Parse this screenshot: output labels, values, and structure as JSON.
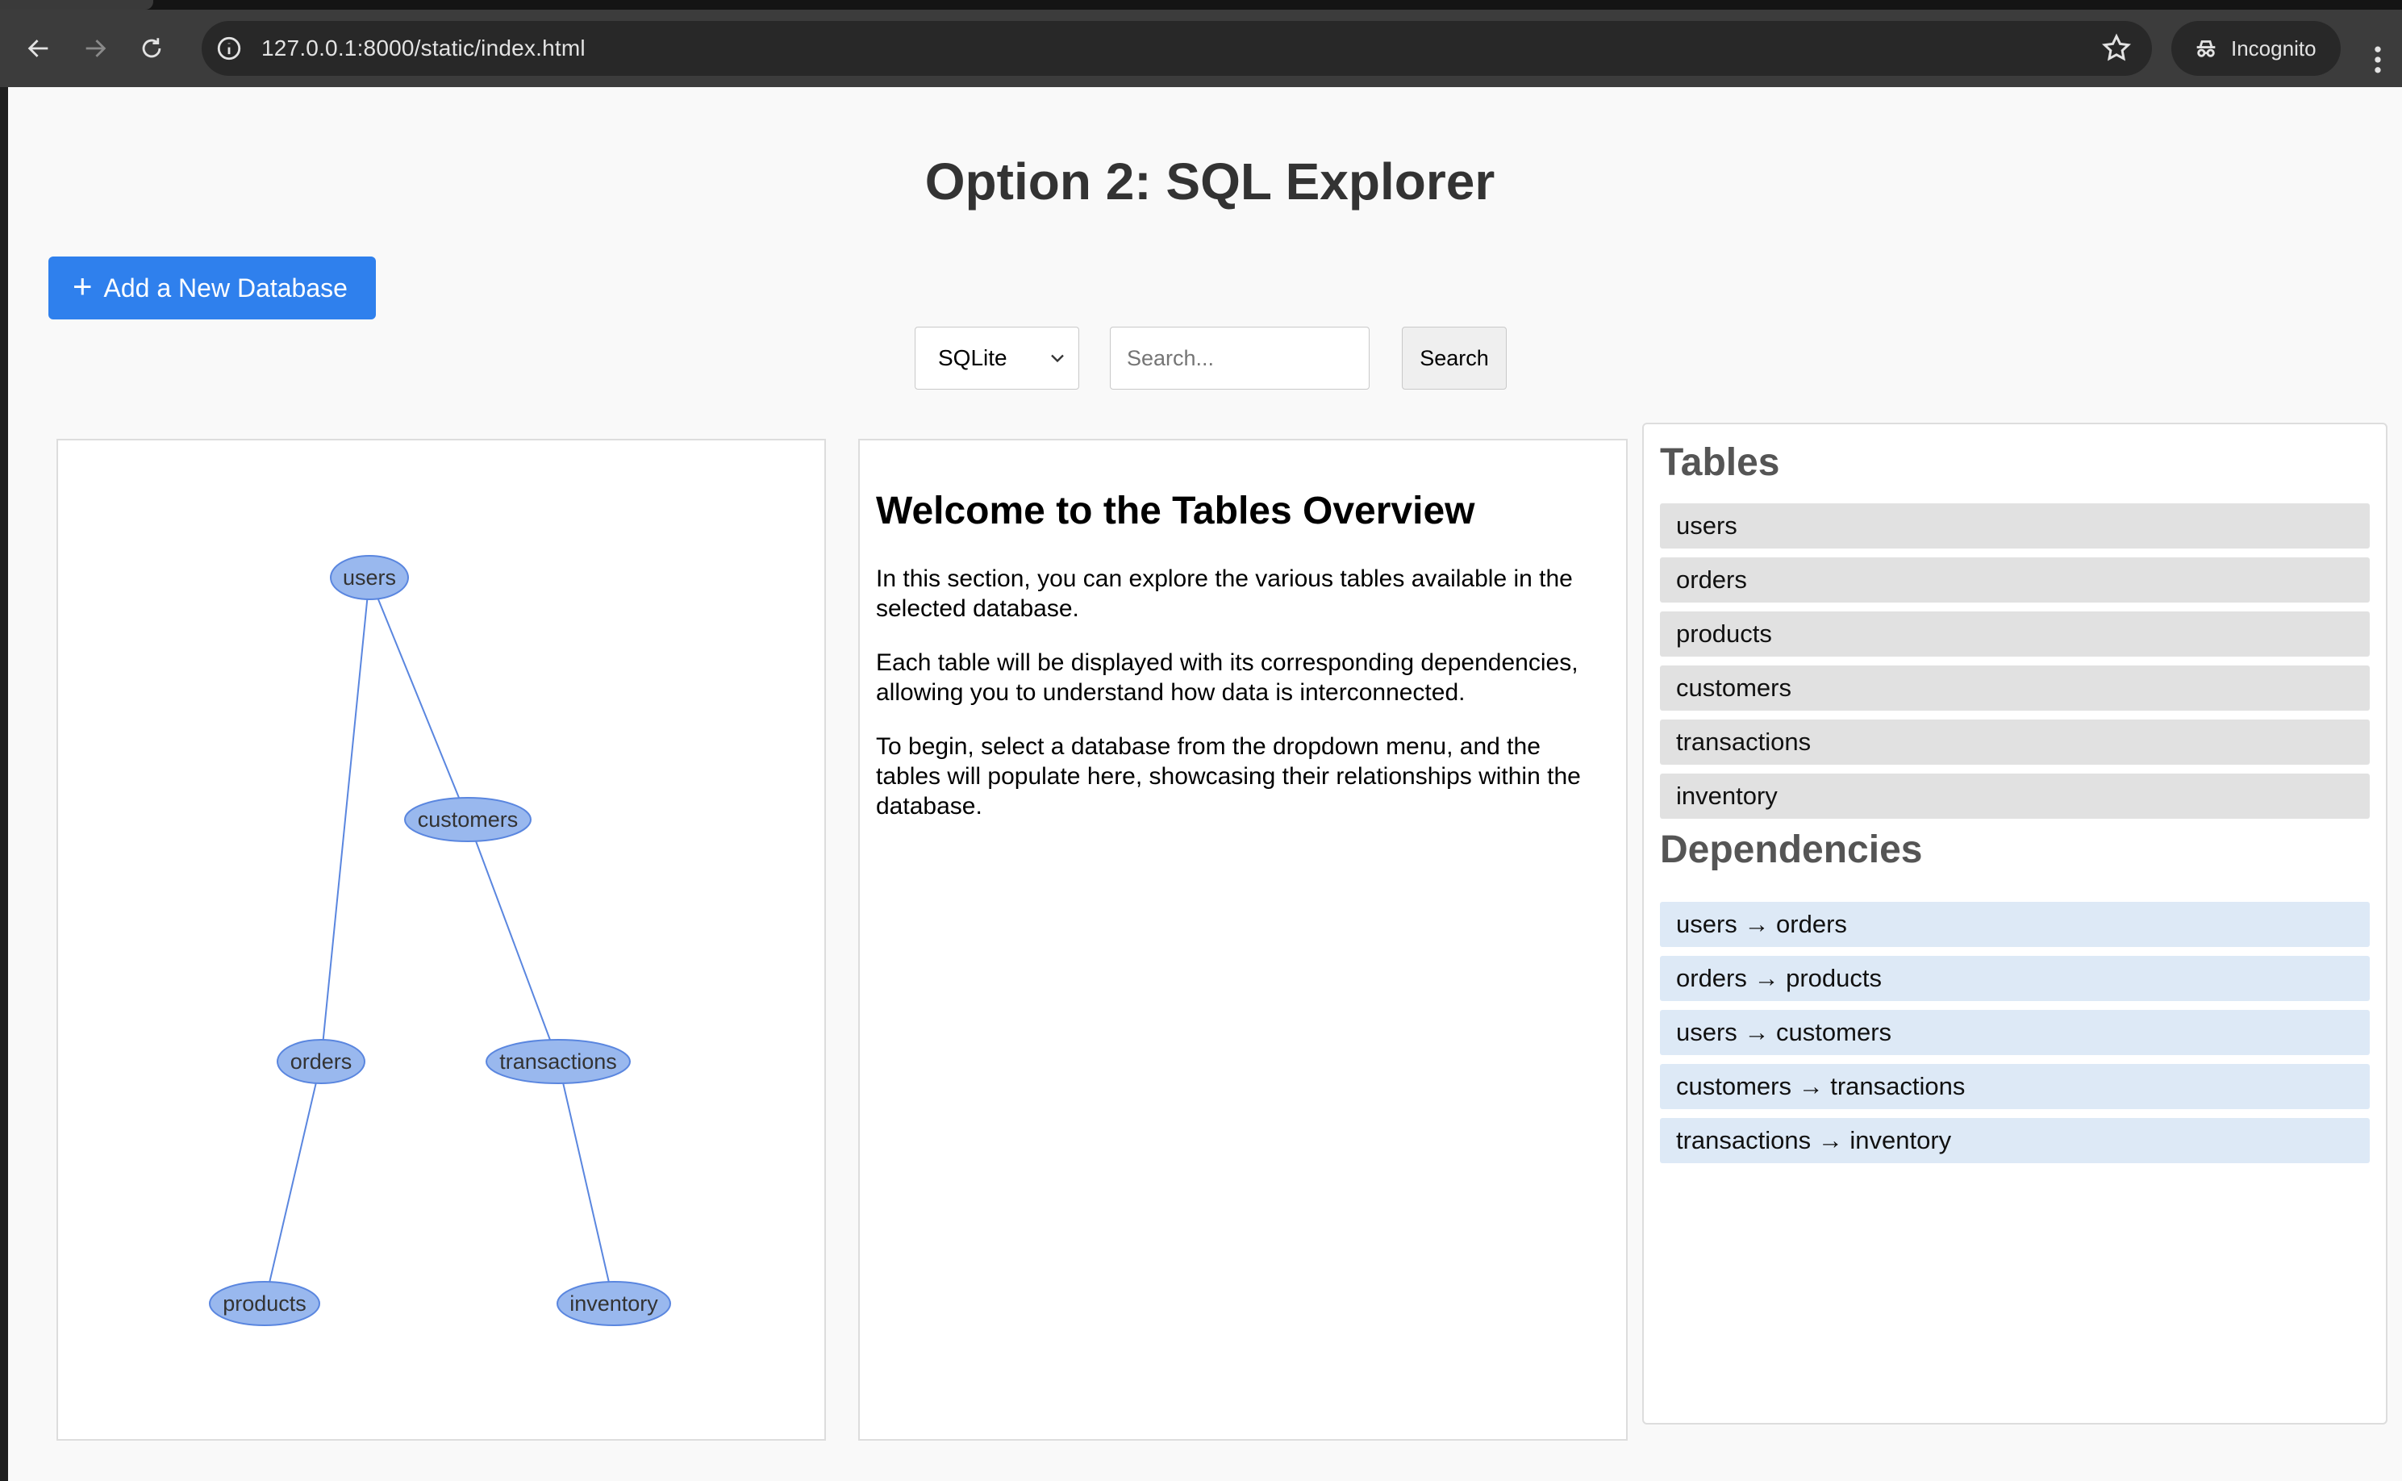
{
  "browser": {
    "url": "127.0.0.1:8000/static/index.html",
    "profile_label": "Incognito",
    "icons": [
      "back-icon",
      "forward-icon",
      "reload-icon",
      "site-info-icon",
      "bookmark-star-icon",
      "incognito-icon",
      "menu-kebab-icon"
    ]
  },
  "page": {
    "title": "Option 2: SQL Explorer",
    "add_db_label": "Add a New Database",
    "db_select": {
      "selected": "SQLite"
    },
    "search": {
      "placeholder": "Search...",
      "button_label": "Search"
    }
  },
  "welcome": {
    "title": "Welcome to the Tables Overview",
    "paragraphs": [
      "In this section, you can explore the various tables available in the selected database.",
      "Each table will be displayed with its corresponding dependencies, allowing you to understand how data is interconnected.",
      "To begin, select a database from the dropdown menu, and the tables will populate here, showcasing their relationships within the database."
    ]
  },
  "sidebar": {
    "tables_title": "Tables",
    "tables": [
      "users",
      "orders",
      "products",
      "customers",
      "transactions",
      "inventory"
    ],
    "dependencies_title": "Dependencies",
    "dependencies": [
      "users → orders",
      "orders → products",
      "users → customers",
      "customers → transactions",
      "transactions → inventory"
    ]
  },
  "graph": {
    "colors": {
      "node_fill": "#99b8ee",
      "node_stroke": "#5a86df",
      "edge": "#5a86df"
    },
    "nodes": [
      "users",
      "customers",
      "orders",
      "transactions",
      "products",
      "inventory"
    ],
    "edges": [
      [
        "users",
        "orders"
      ],
      [
        "users",
        "customers"
      ],
      [
        "customers",
        "transactions"
      ],
      [
        "orders",
        "products"
      ],
      [
        "transactions",
        "inventory"
      ]
    ]
  }
}
